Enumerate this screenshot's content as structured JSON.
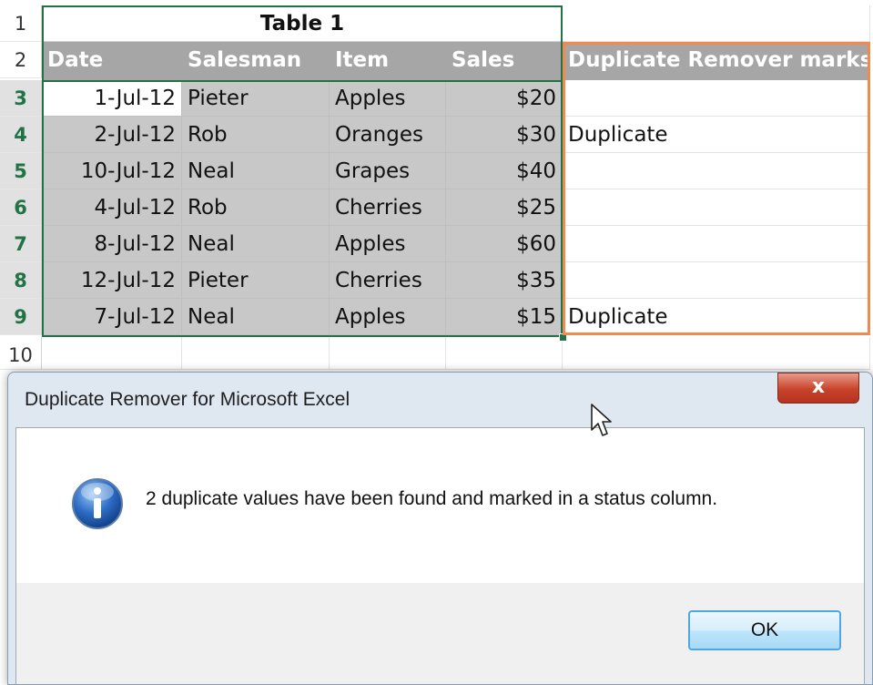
{
  "sheet": {
    "row_numbers": [
      "1",
      "2",
      "3",
      "4",
      "5",
      "6",
      "7",
      "8",
      "9",
      "10"
    ],
    "title": "Table 1",
    "headers": [
      "Date",
      "Salesman",
      "Item",
      "Sales",
      "Duplicate Remover marks"
    ],
    "rows": [
      {
        "date": "1-Jul-12",
        "salesman": "Pieter",
        "item": "Apples",
        "sales": "$20",
        "mark": ""
      },
      {
        "date": "2-Jul-12",
        "salesman": "Rob",
        "item": "Oranges",
        "sales": "$30",
        "mark": "Duplicate"
      },
      {
        "date": "10-Jul-12",
        "salesman": "Neal",
        "item": "Grapes",
        "sales": "$40",
        "mark": ""
      },
      {
        "date": "4-Jul-12",
        "salesman": "Rob",
        "item": "Cherries",
        "sales": "$25",
        "mark": ""
      },
      {
        "date": "8-Jul-12",
        "salesman": "Neal",
        "item": "Apples",
        "sales": "$60",
        "mark": ""
      },
      {
        "date": "12-Jul-12",
        "salesman": "Pieter",
        "item": "Cherries",
        "sales": "$35",
        "mark": ""
      },
      {
        "date": "7-Jul-12",
        "salesman": "Neal",
        "item": "Apples",
        "sales": "$15",
        "mark": "Duplicate"
      }
    ],
    "colors": {
      "selection": "#217346",
      "marks_highlight": "#f4894f",
      "header_fill": "#a6a6a6",
      "data_fill": "#c8c8c8"
    }
  },
  "dialog": {
    "title": "Duplicate Remover for Microsoft Excel",
    "close_label": "x",
    "icon": "info-icon",
    "message": "2 duplicate values have been found and marked in a status column.",
    "ok_label": "OK"
  }
}
